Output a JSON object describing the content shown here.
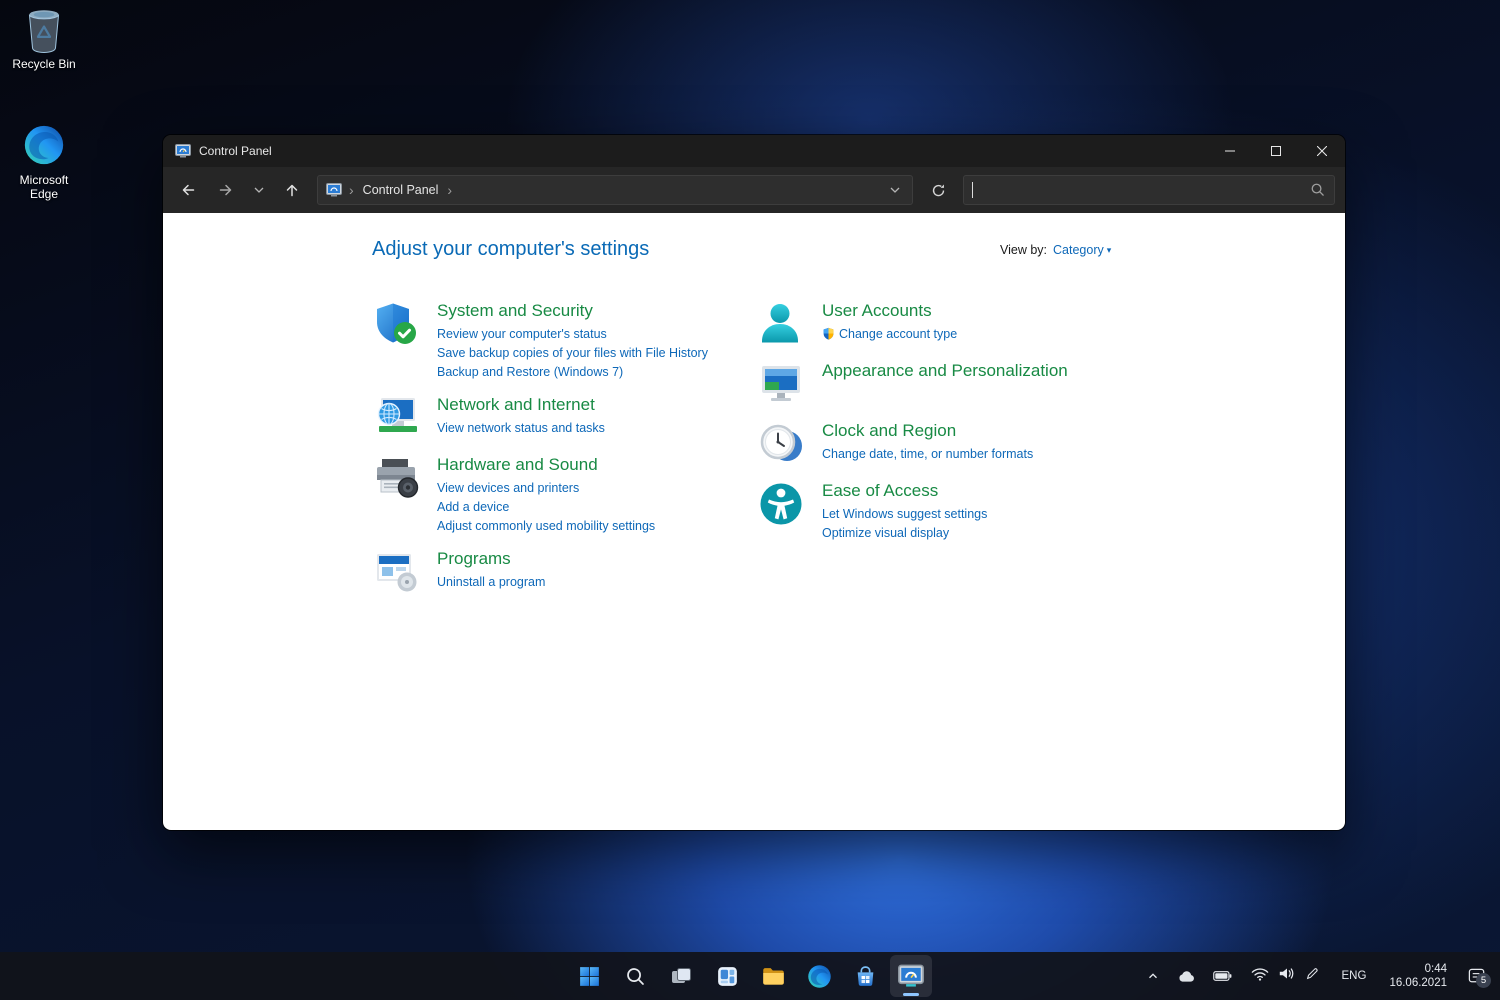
{
  "desktop": {
    "icons": [
      {
        "name": "recycle-bin",
        "label": "Recycle Bin"
      },
      {
        "name": "microsoft-edge",
        "label": "Microsoft Edge"
      }
    ]
  },
  "window": {
    "title": "Control Panel",
    "titlebar_buttons": [
      "minimize",
      "maximize",
      "close"
    ],
    "toolbar": {
      "nav_icons": [
        "back-arrow",
        "forward-arrow",
        "recent-locations-chevron",
        "up-arrow",
        "refresh"
      ],
      "breadcrumb": {
        "icon": "control-panel-icon",
        "root": "Control Panel"
      },
      "search": {
        "value": "",
        "placeholder": "",
        "icon": "search-icon"
      }
    },
    "page": {
      "heading": "Adjust your computer's settings",
      "view_by": {
        "label": "View by:",
        "value": "Category"
      }
    }
  },
  "categories": {
    "left": [
      {
        "icon": "system-security-shield-icon",
        "title": "System and Security",
        "links": [
          "Review your computer's status",
          "Save backup copies of your files with File History",
          "Backup and Restore (Windows 7)"
        ]
      },
      {
        "icon": "network-globe-monitor-icon",
        "title": "Network and Internet",
        "links": [
          "View network status and tasks"
        ]
      },
      {
        "icon": "printer-camera-icon",
        "title": "Hardware and Sound",
        "links": [
          "View devices and printers",
          "Add a device",
          "Adjust commonly used mobility settings"
        ]
      },
      {
        "icon": "program-window-disc-icon",
        "title": "Programs",
        "links": [
          "Uninstall a program"
        ]
      }
    ],
    "right": [
      {
        "icon": "user-silhouette-icon",
        "title": "User Accounts",
        "links": [
          "Change account type"
        ],
        "link_icon": "uac-shield-icon"
      },
      {
        "icon": "personalization-monitor-icon",
        "title": "Appearance and Personalization",
        "links": []
      },
      {
        "icon": "clock-icon",
        "title": "Clock and Region",
        "links": [
          "Change date, time, or number formats"
        ]
      },
      {
        "icon": "ease-of-access-person-icon",
        "title": "Ease of Access",
        "links": [
          "Let Windows suggest settings",
          "Optimize visual display"
        ]
      }
    ]
  },
  "taskbar": {
    "buttons": [
      "start",
      "search",
      "task-view",
      "widgets",
      "file-explorer",
      "microsoft-edge",
      "microsoft-store",
      "control-panel"
    ],
    "active_button": "control-panel",
    "tray": {
      "icons": [
        "hidden-icons-chevron",
        "onedrive-cloud",
        "battery",
        "wifi",
        "volume",
        "pen"
      ],
      "language": "ENG",
      "time": "0:44",
      "date": "16.06.2021",
      "notification_count": "5"
    }
  },
  "colors": {
    "category_title_green": "#188a44",
    "link_blue": "#0e68b8",
    "heading_blue": "#0a6ab6",
    "window_dark": "#1f1f1f",
    "taskbar_dark": "#171a21"
  }
}
